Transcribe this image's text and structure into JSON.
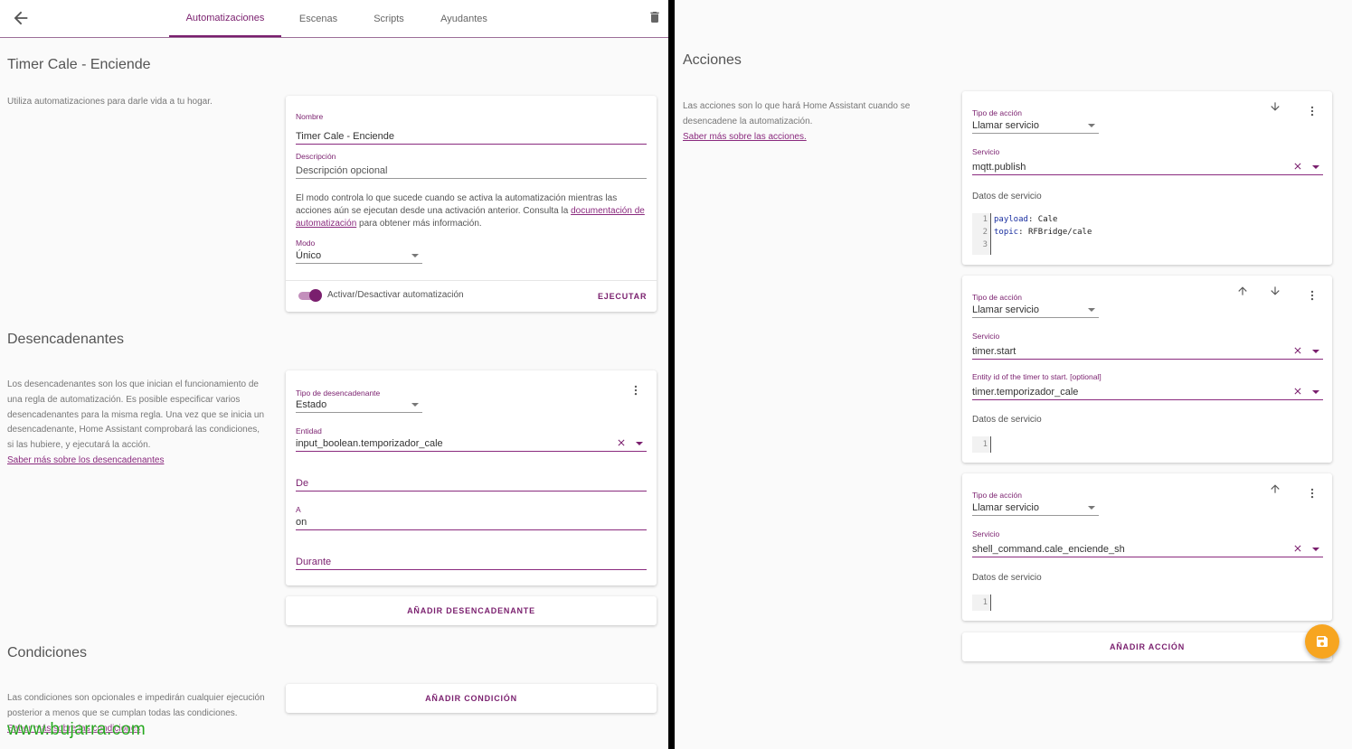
{
  "tabs": [
    {
      "label": "Automatizaciones",
      "active": true
    },
    {
      "label": "Escenas",
      "active": false
    },
    {
      "label": "Scripts",
      "active": false
    },
    {
      "label": "Ayudantes",
      "active": false
    }
  ],
  "page_title": "Timer Cale - Enciende",
  "intro_text": "Utiliza automatizaciones para darle vida a tu hogar.",
  "details_card": {
    "name_label": "Nombre",
    "name_value": "Timer Cale - Enciende",
    "desc_label": "Descripción",
    "desc_placeholder": "Descripción opcional",
    "mode_text_1": "El modo controla lo que sucede cuando se activa la automatización mientras las",
    "mode_text_2": "acciones aún se ejecutan desde una activación anterior. Consulta la",
    "mode_link_1": "documentación de",
    "mode_link_2": "automatización",
    "mode_text_3": "para obtener más información.",
    "mode_label": "Modo",
    "mode_value": "Único",
    "toggle_label": "Activar/Desactivar automatización",
    "toggle_on": true,
    "run_button": "EJECUTAR"
  },
  "triggers_section": {
    "title": "Desencadenantes",
    "desc_lines": [
      "Los desencadenantes son los que inician el funcionamiento de",
      "una regla de automatización. Es posible especificar varios",
      "desencadenantes para la misma regla. Una vez que se inicia un",
      "desencadenante, Home Assistant comprobará las condiciones,",
      "si las hubiere, y ejecutará la acción."
    ],
    "learn_more": "Saber más sobre los desencadenantes",
    "trigger_type_label": "Tipo de desencadenante",
    "trigger_type_value": "Estado",
    "entity_label": "Entidad",
    "entity_value": "input_boolean.temporizador_cale",
    "from_label": "De",
    "to_label": "A",
    "to_value": "on",
    "for_label": "Durante",
    "add_button": "AÑADIR DESENCADENANTE"
  },
  "conditions_section": {
    "title": "Condiciones",
    "desc_lines": [
      "Las condiciones son opcionales e impedirán cualquier ejecución",
      "posterior a menos que se cumplan todas las condiciones."
    ],
    "learn_more": "Saber más sobre las condiciones",
    "add_button": "AÑADIR CONDICIÓN"
  },
  "actions_section": {
    "title": "Acciones",
    "desc_lines": [
      "Las acciones son lo que hará Home Assistant cuando se",
      "desencadene la automatización."
    ],
    "learn_more": "Saber más sobre las acciones.",
    "add_button": "AÑADIR ACCIÓN",
    "actions": [
      {
        "type_label": "Tipo de acción",
        "type_value": "Llamar servicio",
        "service_label": "Servicio",
        "service_value": "mqtt.publish",
        "data_label": "Datos de servicio",
        "code_lines": [
          {
            "key": "payload",
            "value": "Cale"
          },
          {
            "key": "topic",
            "value": "RFBridge/cale"
          }
        ]
      },
      {
        "type_label": "Tipo de acción",
        "type_value": "Llamar servicio",
        "service_label": "Servicio",
        "service_value": "timer.start",
        "entity_label": "Entity id of the timer to start. [optional]",
        "entity_value": "timer.temporizador_cale",
        "data_label": "Datos de servicio"
      },
      {
        "type_label": "Tipo de acción",
        "type_value": "Llamar servicio",
        "service_label": "Servicio",
        "service_value": "shell_command.cale_enciende_sh",
        "data_label": "Datos de servicio"
      }
    ]
  },
  "line_numbers": {
    "a": "1",
    "b": "2",
    "c": "3"
  },
  "code_separator": ": ",
  "watermark": "www.bujarra.com",
  "colors": {
    "accent": "#7a1f6e",
    "fab": "#f7a520",
    "background": "#fafafa"
  },
  "icons": [
    "back-arrow-icon",
    "trash-icon",
    "kebab-menu-icon",
    "clear-icon",
    "dropdown-icon",
    "arrow-up-icon",
    "arrow-down-icon",
    "save-icon"
  ]
}
